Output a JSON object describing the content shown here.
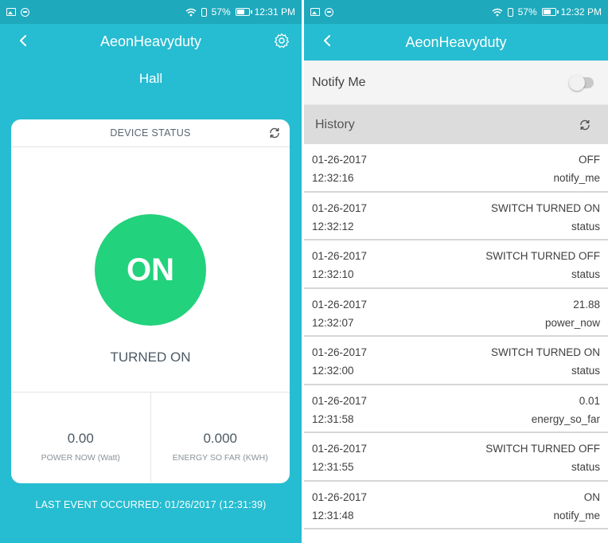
{
  "status_bar_left": {
    "battery": "57%",
    "time": "12:31 PM"
  },
  "status_bar_right": {
    "battery": "57%",
    "time": "12:32 PM"
  },
  "device_screen": {
    "app_title": "AeonHeavyduty",
    "room": "Hall",
    "card": {
      "header": "DEVICE STATUS",
      "state_circle": "ON",
      "state_text": "TURNED ON",
      "metrics": [
        {
          "value": "0.00",
          "label": "POWER NOW (Watt)"
        },
        {
          "value": "0.000",
          "label": "ENERGY SO FAR (KWH)"
        }
      ]
    },
    "last_event": "LAST EVENT OCCURRED: 01/26/2017 (12:31:39)"
  },
  "history_screen": {
    "app_title": "AeonHeavyduty",
    "notify_label": "Notify Me",
    "notify_enabled": false,
    "history_label": "History",
    "rows": [
      {
        "date": "01-26-2017",
        "time": "12:32:16",
        "value": "OFF",
        "attribute": "notify_me"
      },
      {
        "date": "01-26-2017",
        "time": "12:32:12",
        "value": "SWITCH TURNED ON",
        "attribute": "status"
      },
      {
        "date": "01-26-2017",
        "time": "12:32:10",
        "value": "SWITCH TURNED OFF",
        "attribute": "status"
      },
      {
        "date": "01-26-2017",
        "time": "12:32:07",
        "value": "21.88",
        "attribute": "power_now"
      },
      {
        "date": "01-26-2017",
        "time": "12:32:00",
        "value": "SWITCH TURNED ON",
        "attribute": "status"
      },
      {
        "date": "01-26-2017",
        "time": "12:31:58",
        "value": "0.01",
        "attribute": "energy_so_far"
      },
      {
        "date": "01-26-2017",
        "time": "12:31:55",
        "value": "SWITCH TURNED OFF",
        "attribute": "status"
      },
      {
        "date": "01-26-2017",
        "time": "12:31:48",
        "value": "ON",
        "attribute": "notify_me"
      }
    ]
  },
  "colors": {
    "primary": "#26bcd1",
    "status_bar": "#1ea9bd",
    "on_green": "#22d27c"
  },
  "icons": [
    "image-icon",
    "block-icon",
    "wifi-icon",
    "phone-icon",
    "battery-icon",
    "back-arrow-icon",
    "gear-icon",
    "refresh-icon"
  ]
}
